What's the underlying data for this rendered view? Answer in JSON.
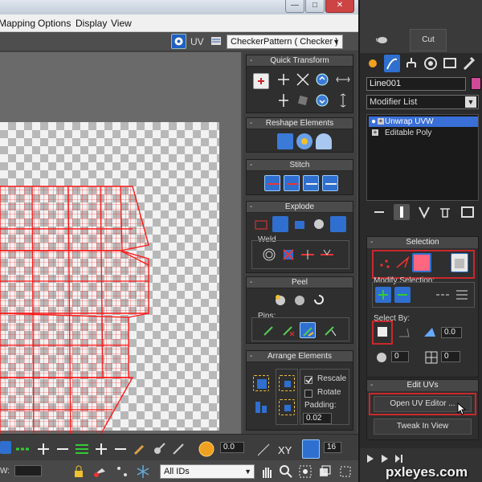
{
  "menubar": {
    "items": [
      "Mapping",
      "Options",
      "Display",
      "View"
    ]
  },
  "uv_toolbar": {
    "uv_label": "UV",
    "texture_combo": "CheckerPattern  ( Checker )"
  },
  "rollups": {
    "quick_transform": "Quick Transform",
    "reshape": "Reshape Elements",
    "stitch": "Stitch",
    "explode": "Explode",
    "weld": "Weld",
    "peel": "Peel",
    "pins": "Pins:",
    "arrange": "Arrange Elements",
    "rescale": "Rescale",
    "rotate": "Rotate",
    "padding_label": "Padding:",
    "padding_value": "0.02",
    "collapse_mark": "-"
  },
  "statusbar": {
    "value1": "0.0",
    "xy_label": "XY",
    "value2": "16",
    "w_label": "W:",
    "ids_combo": "All IDs"
  },
  "cmdpanel": {
    "cut_label": "Cut",
    "object_name": "Line001",
    "modifier_list": "Modifier List",
    "stack": [
      "Unwrap UVW",
      "Editable Poly"
    ],
    "selection_title": "Selection",
    "modify_selection": "Modify Selection:",
    "select_by": "Select By:",
    "spin1": "0.0",
    "spin2": "0",
    "spin3": "0",
    "edit_uvs_title": "Edit UVs",
    "open_uv_editor": "Open UV Editor ...",
    "tweak_in_view": "Tweak In View"
  },
  "watermark": "pxleyes.com",
  "colors": {
    "accent_red": "#c8282d",
    "stack_highlight": "#3a6fd8",
    "object_color": "#d14a9a",
    "mesh_red": "#ff1a1a"
  }
}
